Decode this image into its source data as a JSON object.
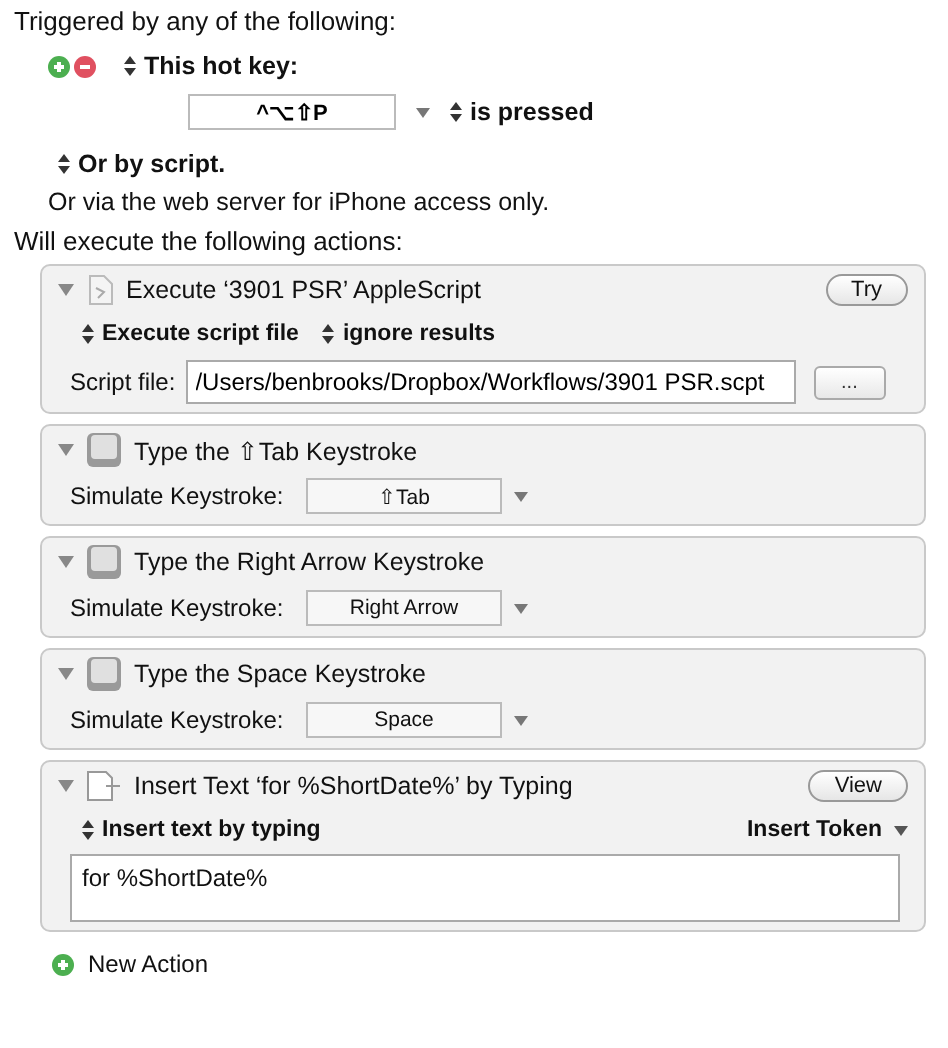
{
  "trigger": {
    "heading": "Triggered by any of the following:",
    "hotkey_label": "This hot key:",
    "hotkey": "^⌥⇧P",
    "condition": "is pressed",
    "script_option": "Or by script.",
    "web_note": "Or via the web server for iPhone access only."
  },
  "actions_heading": "Will execute the following actions:",
  "actions": [
    {
      "kind": "applescript",
      "expanded": true,
      "title": "Execute ‘3901 PSR’ AppleScript",
      "button": "Try",
      "mode": "Execute script file",
      "results": "ignore results",
      "file_label": "Script file:",
      "file_path": "/Users/benbrooks/Dropbox/Workflows/3901 PSR.scpt",
      "browse": "..."
    },
    {
      "kind": "keystroke",
      "expanded": true,
      "title": "Type the ⇧Tab Keystroke",
      "label": "Simulate Keystroke:",
      "key": "⇧Tab"
    },
    {
      "kind": "keystroke",
      "expanded": true,
      "title": "Type the Right Arrow Keystroke",
      "label": "Simulate Keystroke:",
      "key": "Right Arrow"
    },
    {
      "kind": "keystroke",
      "expanded": true,
      "title": "Type the Space Keystroke",
      "label": "Simulate Keystroke:",
      "key": "Space"
    },
    {
      "kind": "insert_text",
      "expanded": true,
      "title": "Insert Text ‘for %ShortDate%’ by Typing",
      "button": "View",
      "mode": "Insert text by typing",
      "token_menu": "Insert Token",
      "text": "for %ShortDate%"
    }
  ],
  "new_action": "New Action"
}
